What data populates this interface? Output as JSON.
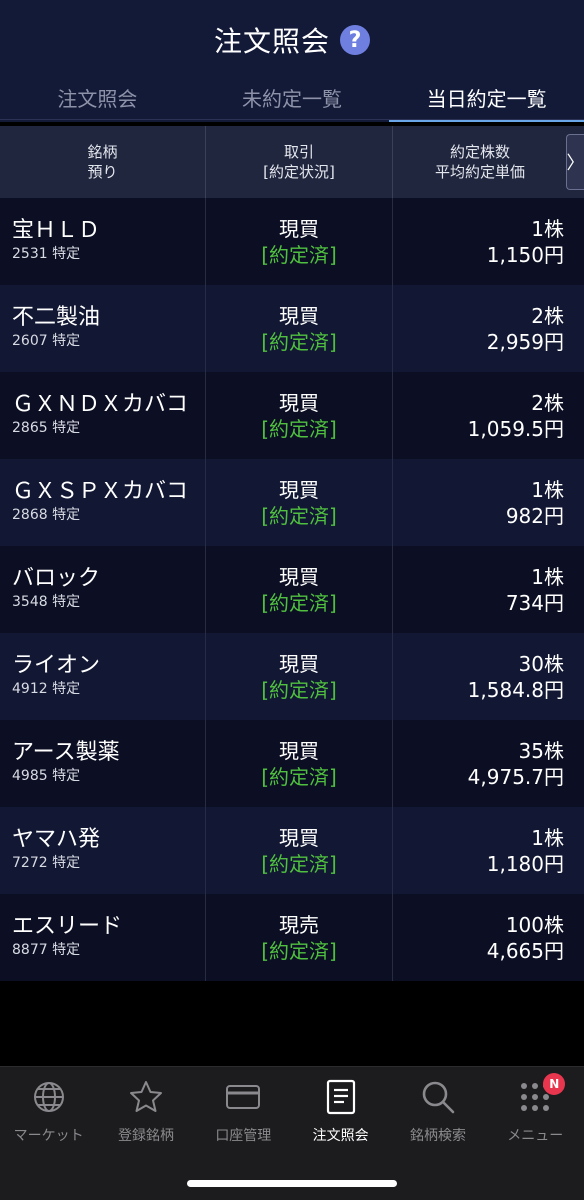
{
  "header": {
    "title": "注文照会",
    "help_glyph": "?",
    "tabs": [
      {
        "label": "注文照会",
        "active": false
      },
      {
        "label": "未約定一覧",
        "active": false
      },
      {
        "label": "当日約定一覧",
        "active": true
      }
    ]
  },
  "table": {
    "columns": [
      {
        "line1": "銘柄",
        "line2": "預り"
      },
      {
        "line1": "取引",
        "line2": "[約定状況]"
      },
      {
        "line1": "約定株数",
        "line2": "平均約定単価"
      }
    ],
    "next_glyph": "〉",
    "rows": [
      {
        "name": "宝ＨＬＤ",
        "code": "2531 特定",
        "type": "現買",
        "status": "[約定済]",
        "qty": "1株",
        "price": "1,150円"
      },
      {
        "name": "不二製油",
        "code": "2607 特定",
        "type": "現買",
        "status": "[約定済]",
        "qty": "2株",
        "price": "2,959円"
      },
      {
        "name": "ＧＸＮＤＸカバコ",
        "code": "2865 特定",
        "type": "現買",
        "status": "[約定済]",
        "qty": "2株",
        "price": "1,059.5円"
      },
      {
        "name": "ＧＸＳＰＸカバコ",
        "code": "2868 特定",
        "type": "現買",
        "status": "[約定済]",
        "qty": "1株",
        "price": "982円"
      },
      {
        "name": "バロック",
        "code": "3548 特定",
        "type": "現買",
        "status": "[約定済]",
        "qty": "1株",
        "price": "734円"
      },
      {
        "name": "ライオン",
        "code": "4912 特定",
        "type": "現買",
        "status": "[約定済]",
        "qty": "30株",
        "price": "1,584.8円"
      },
      {
        "name": "アース製薬",
        "code": "4985 特定",
        "type": "現買",
        "status": "[約定済]",
        "qty": "35株",
        "price": "4,975.7円"
      },
      {
        "name": "ヤマハ発",
        "code": "7272 特定",
        "type": "現買",
        "status": "[約定済]",
        "qty": "1株",
        "price": "1,180円"
      },
      {
        "name": "エスリード",
        "code": "8877 特定",
        "type": "現売",
        "status": "[約定済]",
        "qty": "100株",
        "price": "4,665円"
      }
    ]
  },
  "bottom_nav": {
    "items": [
      {
        "label": "マーケット",
        "icon": "globe-icon",
        "active": false
      },
      {
        "label": "登録銘柄",
        "icon": "star-icon",
        "active": false
      },
      {
        "label": "口座管理",
        "icon": "card-icon",
        "active": false
      },
      {
        "label": "注文照会",
        "icon": "document-icon",
        "active": true
      },
      {
        "label": "銘柄検索",
        "icon": "search-icon",
        "active": false
      },
      {
        "label": "メニュー",
        "icon": "grid-menu-icon",
        "active": false
      }
    ],
    "menu_badge": "N"
  },
  "colors": {
    "header_bg": "#131a38",
    "active_tab_underline": "#6aa7e8",
    "status_green": "#4fbf3f",
    "badge_red": "#e8364f"
  }
}
